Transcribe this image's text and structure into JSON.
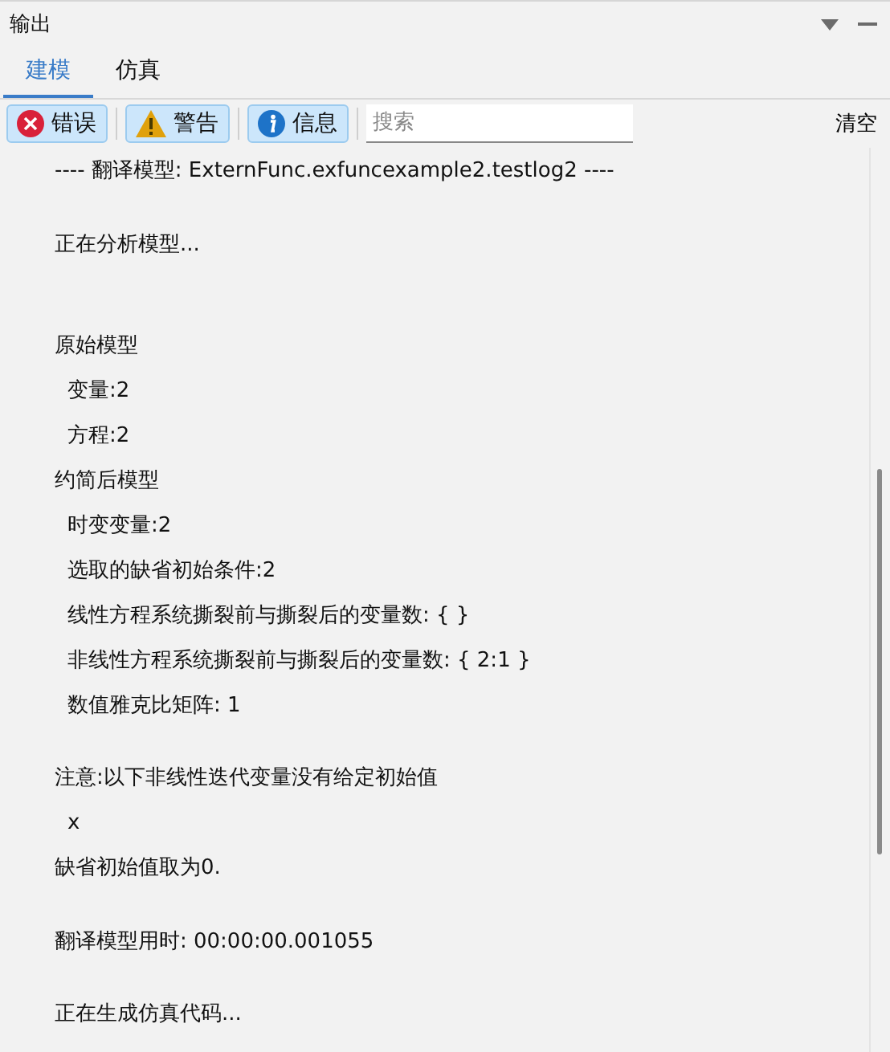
{
  "panel": {
    "title": "输出"
  },
  "tabs": [
    {
      "label": "建模",
      "selected": true
    },
    {
      "label": "仿真",
      "selected": false
    }
  ],
  "filters": [
    {
      "kind": "error",
      "label": "错误",
      "on": true
    },
    {
      "kind": "warning",
      "label": "警告",
      "on": true
    },
    {
      "kind": "info",
      "label": "信息",
      "on": true
    }
  ],
  "search": {
    "placeholder": "搜索"
  },
  "clear_button": "清空",
  "log": [
    {
      "kind": "line",
      "text": "---- 翻译模型: ExternFunc.exfuncexample2.testlog2 ----"
    },
    {
      "kind": "blank"
    },
    {
      "kind": "line",
      "text": "正在分析模型..."
    },
    {
      "kind": "blank"
    },
    {
      "kind": "blank"
    },
    {
      "kind": "line",
      "text": "原始模型",
      "children": [
        {
          "kind": "line",
          "text": "变量:2"
        },
        {
          "kind": "line",
          "text": "方程:2"
        }
      ]
    },
    {
      "kind": "line",
      "text": "约简后模型",
      "children": [
        {
          "kind": "line",
          "text": "时变变量:2"
        },
        {
          "kind": "line",
          "text": "选取的缺省初始条件:2"
        },
        {
          "kind": "line",
          "text": "线性方程系统撕裂前与撕裂后的变量数: { }"
        },
        {
          "kind": "line",
          "text": "非线性方程系统撕裂前与撕裂后的变量数: { 2:1 }"
        },
        {
          "kind": "line",
          "text": "数值雅克比矩阵: 1"
        }
      ]
    },
    {
      "kind": "blank"
    },
    {
      "kind": "line",
      "text": "注意:以下非线性迭代变量没有给定初始值",
      "children": [
        {
          "kind": "line",
          "text": "x"
        }
      ]
    },
    {
      "kind": "line",
      "text": "缺省初始值取为0."
    },
    {
      "kind": "blank"
    },
    {
      "kind": "line",
      "text": "翻译模型用时: 00:00:00.001055"
    },
    {
      "kind": "blank"
    },
    {
      "kind": "line",
      "text": "正在生成仿真代码..."
    }
  ]
}
